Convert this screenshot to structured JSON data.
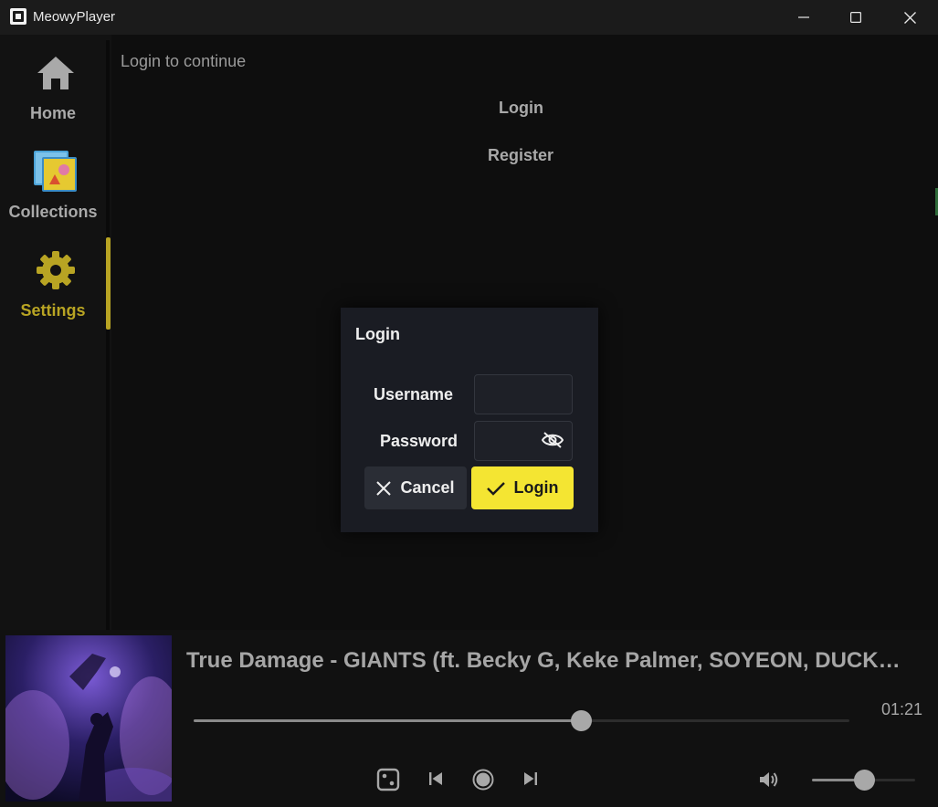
{
  "window": {
    "title": "MeowyPlayer",
    "controls": [
      "minimize-icon",
      "maximize-icon",
      "close-icon"
    ]
  },
  "sidebar": {
    "items": [
      {
        "label": "Home",
        "icon": "home-icon",
        "color": "#a9a9a9",
        "active": false
      },
      {
        "label": "Collections",
        "icon": "collections-icon",
        "color": "#a9a9a9",
        "active": false
      },
      {
        "label": "Settings",
        "icon": "gear-icon",
        "color": "#b8a423",
        "active": true
      }
    ]
  },
  "main": {
    "subtitle": "Login to continue",
    "tabs": [
      {
        "label": "Login"
      },
      {
        "label": "Register"
      }
    ]
  },
  "dialog": {
    "title": "Login",
    "username_label": "Username",
    "username_value": "",
    "password_label": "Password",
    "password_value": "",
    "password_toggle_icon": "eye-off-icon",
    "cancel_label": "Cancel",
    "login_label": "Login",
    "accent_color": "#f4e532"
  },
  "player": {
    "track_title": "True Damage - GIANTS (ft. Becky G, Keke Palmer, SOYEON, DUCKWORTH, Thutmose)",
    "elapsed": "01:21",
    "progress": 0.59,
    "volume": 0.5,
    "controls": [
      "shuffle-icon",
      "previous-icon",
      "play-pause-icon",
      "next-icon",
      "volume-icon"
    ]
  }
}
